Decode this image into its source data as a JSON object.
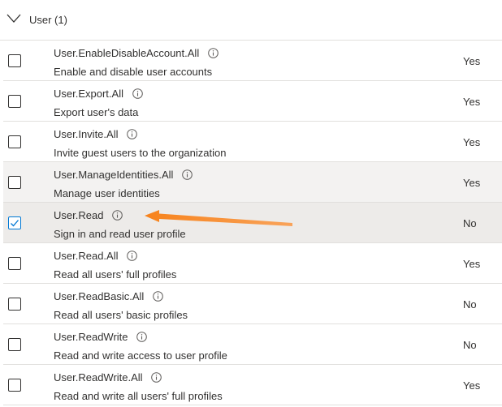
{
  "group": {
    "title": "User (1)"
  },
  "rows": [
    {
      "name": "User.EnableDisableAccount.All",
      "description": "Enable and disable user accounts",
      "admin_consent": "Yes",
      "checked": false
    },
    {
      "name": "User.Export.All",
      "description": "Export user's data",
      "admin_consent": "Yes",
      "checked": false
    },
    {
      "name": "User.Invite.All",
      "description": "Invite guest users to the organization",
      "admin_consent": "Yes",
      "checked": false
    },
    {
      "name": "User.ManageIdentities.All",
      "description": "Manage user identities",
      "admin_consent": "Yes",
      "checked": false
    },
    {
      "name": "User.Read",
      "description": "Sign in and read user profile",
      "admin_consent": "No",
      "checked": true
    },
    {
      "name": "User.Read.All",
      "description": "Read all users' full profiles",
      "admin_consent": "Yes",
      "checked": false
    },
    {
      "name": "User.ReadBasic.All",
      "description": "Read all users' basic profiles",
      "admin_consent": "No",
      "checked": false
    },
    {
      "name": "User.ReadWrite",
      "description": "Read and write access to user profile",
      "admin_consent": "No",
      "checked": false
    },
    {
      "name": "User.ReadWrite.All",
      "description": "Read and write all users' full profiles",
      "admin_consent": "Yes",
      "checked": false
    }
  ],
  "colors": {
    "checkbox_checked": "#0078d4",
    "annotation_arrow": "#f7821b",
    "row_hover": "#f3f2f1",
    "row_selected": "#edebe9",
    "divider": "#e1dfdd"
  },
  "icons": {
    "expand": "chevron-down-icon",
    "info": "info-icon",
    "check": "checkmark-icon"
  }
}
